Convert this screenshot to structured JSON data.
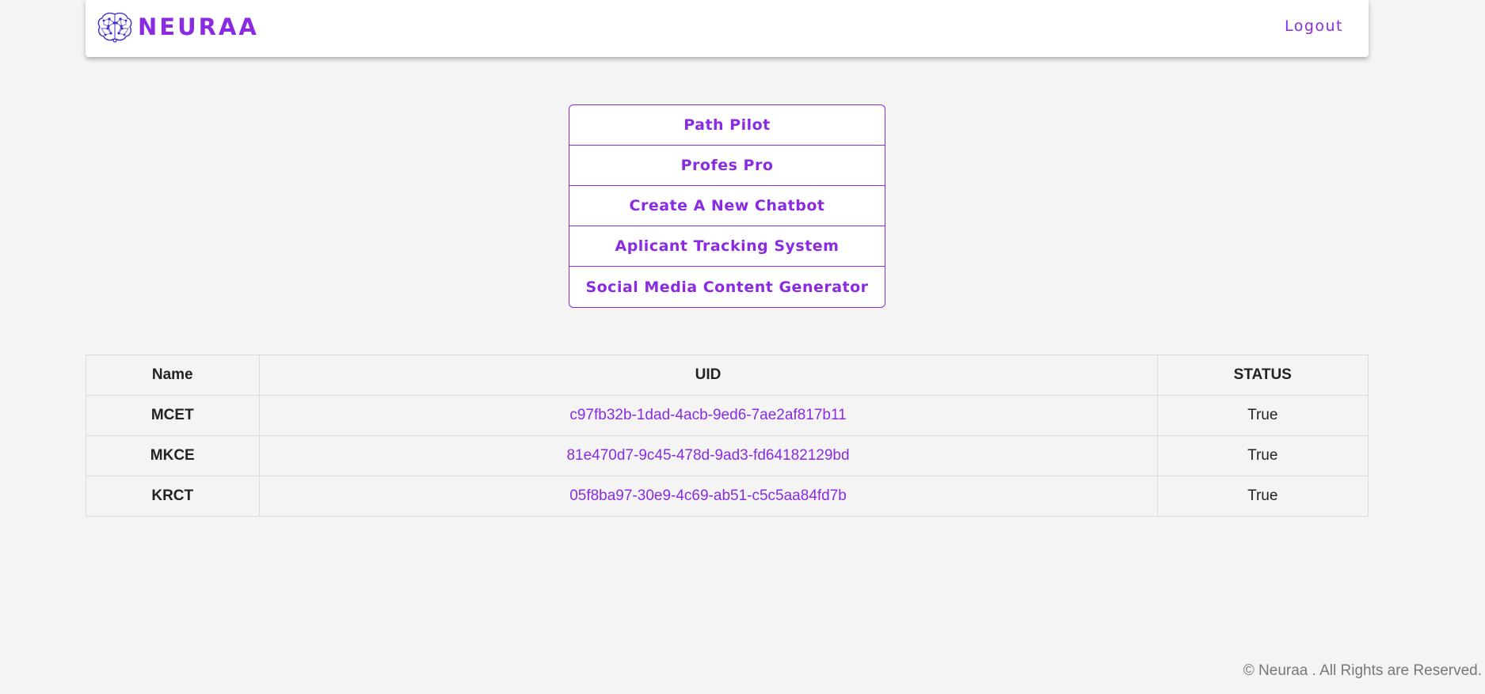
{
  "header": {
    "brand_name": "NEURAA",
    "brand_icon": "brain-icon",
    "logout_label": "Logout"
  },
  "menu": {
    "items": [
      {
        "label": "Path Pilot"
      },
      {
        "label": "Profes Pro"
      },
      {
        "label": "Create A New Chatbot"
      },
      {
        "label": "Aplicant Tracking System"
      },
      {
        "label": "Social Media Content Generator"
      }
    ]
  },
  "table": {
    "headers": [
      "Name",
      "UID",
      "STATUS"
    ],
    "rows": [
      {
        "name": "MCET",
        "uid": "c97fb32b-1dad-4acb-9ed6-7ae2af817b11",
        "status": "True"
      },
      {
        "name": "MKCE",
        "uid": "81e470d7-9c45-478d-9ad3-fd64182129bd",
        "status": "True"
      },
      {
        "name": "KRCT",
        "uid": "05f8ba97-30e9-4c69-ab51-c5c5aa84fd7b",
        "status": "True"
      }
    ]
  },
  "footer": {
    "text": "© Neuraa . All Rights are Reserved."
  },
  "colors": {
    "accent": "#8a2be2",
    "background": "#f4f4f4",
    "text": "#222222",
    "muted": "#777777"
  }
}
